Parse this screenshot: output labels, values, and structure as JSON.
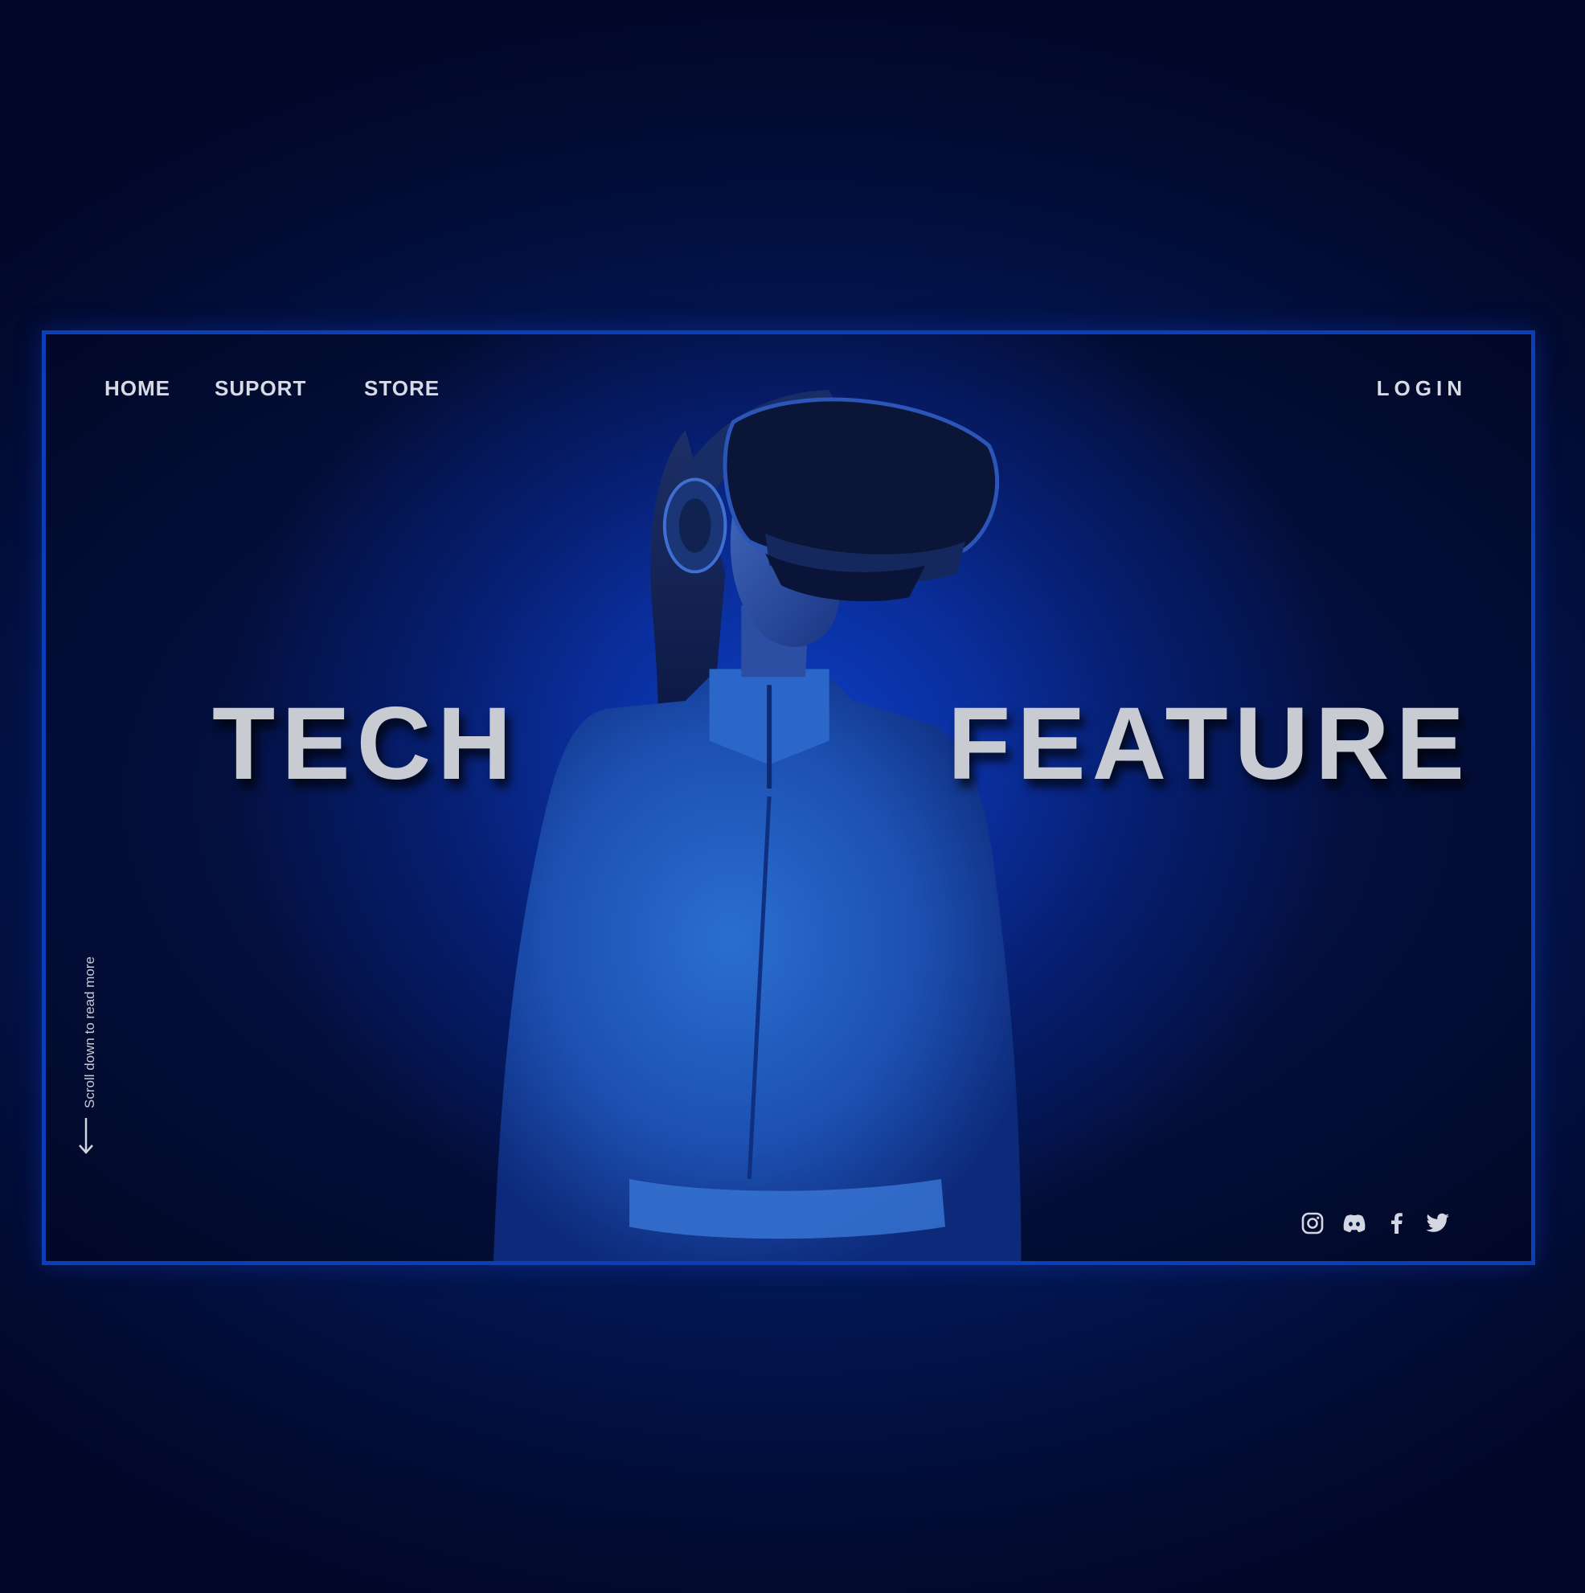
{
  "nav": {
    "items": [
      {
        "label": "HOME"
      },
      {
        "label": "SUPORT"
      },
      {
        "label": "STORE"
      }
    ],
    "login": "LOGIN"
  },
  "hero": {
    "word_left": "TECH",
    "word_right": "FEATURE",
    "image": "woman-wearing-vr-headset"
  },
  "scroll_hint": {
    "text": "Scroll down to read more",
    "icon": "arrow-down-icon"
  },
  "socials": [
    {
      "icon": "instagram-icon"
    },
    {
      "icon": "discord-icon"
    },
    {
      "icon": "facebook-icon"
    },
    {
      "icon": "twitter-icon"
    }
  ],
  "colors": {
    "accent": "#0b3fb8",
    "text": "#d8dbe6",
    "background": "#020b33"
  }
}
